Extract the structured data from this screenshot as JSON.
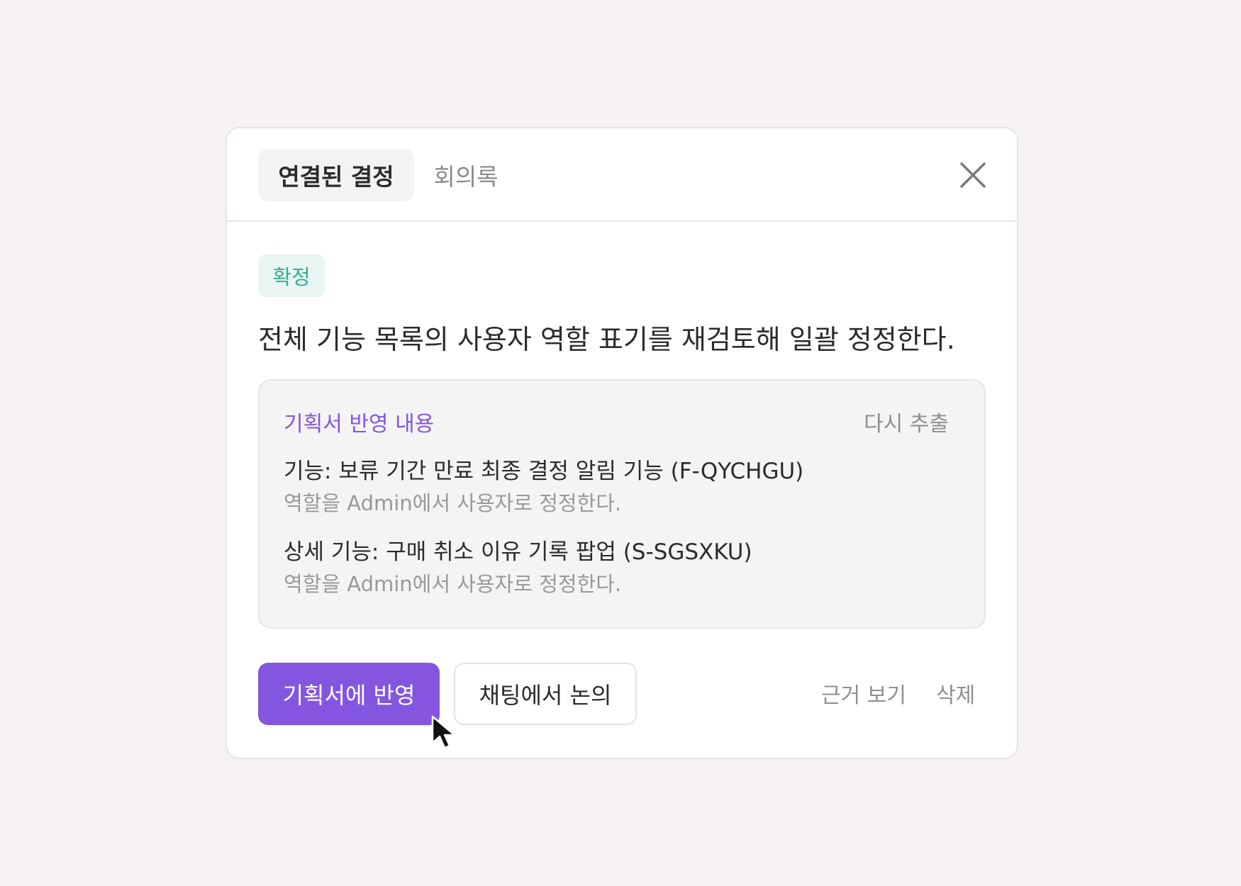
{
  "tabs": {
    "active_label": "연결된 결정",
    "inactive_label": "회의록"
  },
  "decision": {
    "status": "확정",
    "title": "전체 기능 목록의 사용자 역할 표기를 재검토해 일괄 정정한다."
  },
  "reflect_box": {
    "heading": "기획서 반영 내용",
    "reextract_label": "다시 추출",
    "items": [
      {
        "title": "기능: 보류 기간 만료 최종 결정 알림 기능 (F-QYCHGU)",
        "description": "역할을 Admin에서 사용자로 정정한다."
      },
      {
        "title": "상세 기능: 구매 취소 이유 기록 팝업 (S-SGSXKU)",
        "description": "역할을 Admin에서 사용자로 정정한다."
      }
    ]
  },
  "actions": {
    "apply_label": "기획서에 반영",
    "discuss_label": "채팅에서 논의",
    "evidence_label": "근거 보기",
    "delete_label": "삭제"
  },
  "colors": {
    "accent": "#8456e0",
    "status_text": "#36ad94",
    "status_bg": "#e9f6f3",
    "background": "#f6f3f2"
  },
  "icons": {
    "close": "close-icon",
    "cursor": "mouse-pointer-icon"
  }
}
